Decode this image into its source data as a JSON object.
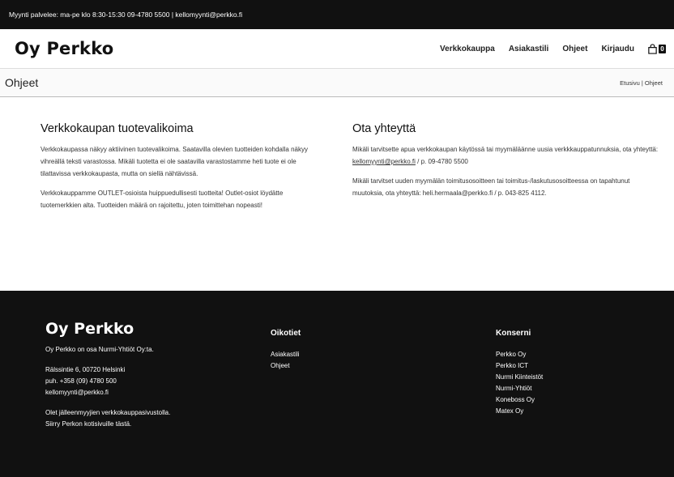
{
  "topbar": {
    "text": "Myynti palvelee: ma-pe klo 8:30-15:30   09-4780 5500 | kellomyynti@perkko.fi"
  },
  "header": {
    "logo": "Oy Perkko",
    "nav": [
      "Verkkokauppa",
      "Asiakastili",
      "Ohjeet",
      "Kirjaudu"
    ],
    "cart_count": "0"
  },
  "pagebar": {
    "title": "Ohjeet",
    "breadcrumb_home": "Etusivu",
    "breadcrumb_sep": "|",
    "breadcrumb_current": "Ohjeet"
  },
  "left": {
    "heading": "Verkkokaupan tuotevalikoima",
    "p1": "Verkkokaupassa näkyy aktiivinen tuotevalikoima. Saatavilla olevien tuotteiden kohdalla näkyy vihreällä teksti varastossa.  Mikäli tuotetta ei ole saatavilla varastostamme heti tuote ei ole tilattavissa verkkokaupasta, mutta on siellä nähtävissä.",
    "p2": "Verkkokauppamme OUTLET-osioista huippuedullisesti tuotteita! Outlet-osiot löydätte tuotemerkkien alta. Tuotteiden määrä on rajoitettu, joten toimittehan nopeasti!"
  },
  "right": {
    "heading": "Ota yhteyttä",
    "p1_pre": "Mikäli tarvitsette apua verkkokaupan käytössä tai myymäläänne uusia verkkkauppatunnuksia, ota yhteyttä: ",
    "p1_email": "kellomyynti@perkko.fi",
    "p1_post": " / p. 09-4780 5500",
    "p2": "Mikäli tarvitset uuden myymälän toimitusosoitteen tai toimitus-/laskutusosoitteessa on tapahtunut muutoksia, ota yhteyttä: heli.hermaala@perkko.fi / p. 043-825 4112."
  },
  "footer": {
    "logo": "Oy Perkko",
    "about": "Oy Perkko on osa Nurmi-Yhtiöt Oy:ta.",
    "address": "Rälssintie 6, 00720 Helsinki",
    "phone": "puh. +358 (09) 4780 500",
    "email": "kellomyynti@perkko.fi",
    "reseller": "Olet jälleenmyyjien verkkokauppasivustolla. Siirry Perkon kotisivuille tästä.",
    "shortcuts_heading": "Oikotiet",
    "shortcuts": [
      "Asiakastili",
      "Ohjeet"
    ],
    "group_heading": "Konserni",
    "group": [
      "Perkko Oy",
      "Perkko ICT",
      "Nurmi Kiinteistöt",
      "Nurmi-Yhtiöt",
      "Koneboss Oy",
      "Matex Oy"
    ]
  }
}
